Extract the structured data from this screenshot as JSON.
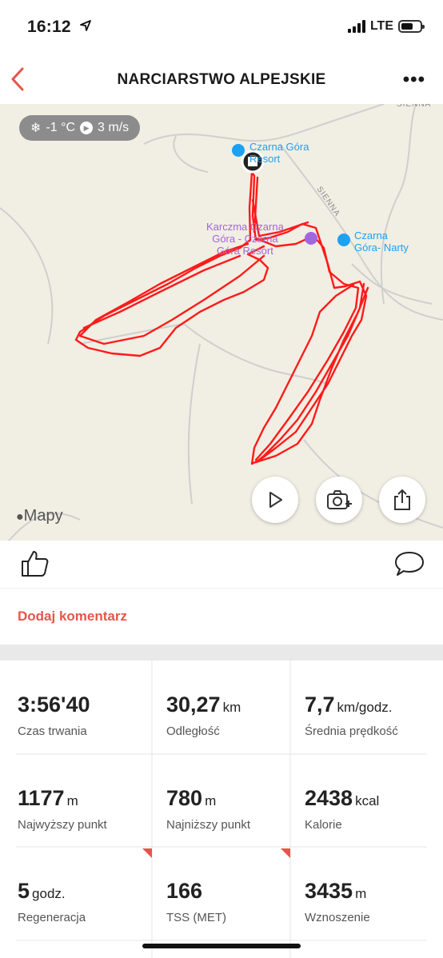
{
  "status": {
    "time": "16:12",
    "network": "LTE"
  },
  "nav": {
    "title": "NARCIARSTWO ALPEJSKIE",
    "more": "•••"
  },
  "map": {
    "weather_temp": "-1 °C",
    "weather_wind": "3 m/s",
    "street_top": "SIENNA",
    "street_diag": "SIENNA",
    "poi_resort": "Czarna Góra\nResort",
    "poi_karczma": "Karczma Czarna\nGóra - Czarna\nGóra Resort",
    "poi_narty": "Czarna\nGóra- Narty",
    "attribution": "Mapy",
    "route_color": "#ff1a1a"
  },
  "comment": {
    "add_label": "Dodaj komentarz"
  },
  "stats": [
    {
      "value": "3:56'40",
      "unit": "",
      "label": "Czas trwania"
    },
    {
      "value": "30,27",
      "unit": "km",
      "label": "Odległość"
    },
    {
      "value": "7,7",
      "unit": "km/godz.",
      "label": "Średnia prędkość"
    },
    {
      "value": "1177",
      "unit": "m",
      "label": "Najwyższy punkt"
    },
    {
      "value": "780",
      "unit": "m",
      "label": "Najniższy punkt"
    },
    {
      "value": "2438",
      "unit": "kcal",
      "label": "Kalorie"
    },
    {
      "value": "5",
      "unit": "godz.",
      "label": "Regeneracja"
    },
    {
      "value": "166",
      "unit": "",
      "label": "TSS (MET)"
    },
    {
      "value": "3435",
      "unit": "m",
      "label": "Wznoszenie"
    }
  ],
  "colors": {
    "accent": "#e8544a",
    "route": "#ff1a1a",
    "poi": "#1da1f2",
    "poi_restaurant": "#a066e0"
  }
}
